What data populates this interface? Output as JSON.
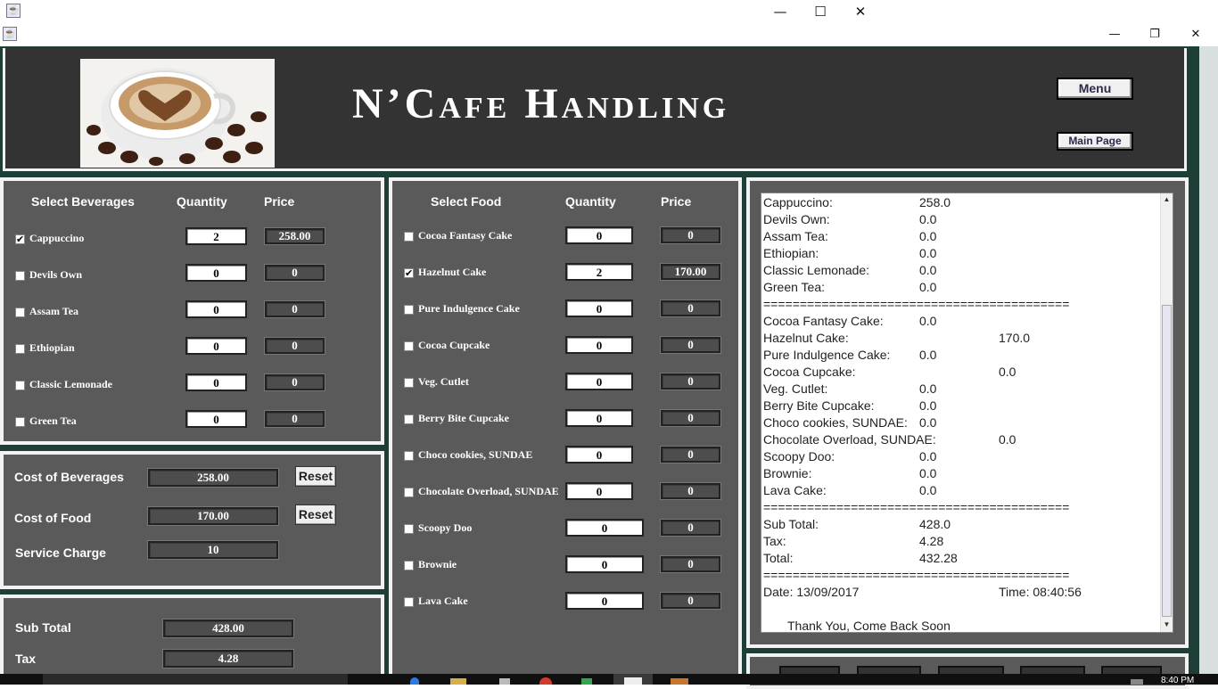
{
  "window": {
    "title_icon": "java-icon",
    "inner_icon": "java-icon",
    "minimize_glyph": "—",
    "maximize_glyph": "☐",
    "close_glyph": "✕",
    "restore_glyph": "❐"
  },
  "header": {
    "title": "N’Cafe Handling",
    "menu_button": "Menu",
    "main_page_button": "Main Page"
  },
  "beverages": {
    "heading_select": "Select Beverages",
    "heading_quantity": "Quantity",
    "heading_price": "Price",
    "items": [
      {
        "label": "Cappuccino",
        "checked": true,
        "quantity": "2",
        "price": "258.00"
      },
      {
        "label": "Devils Own",
        "checked": false,
        "quantity": "0",
        "price": "0"
      },
      {
        "label": "Assam Tea",
        "checked": false,
        "quantity": "0",
        "price": "0"
      },
      {
        "label": "Ethiopian",
        "checked": false,
        "quantity": "0",
        "price": "0"
      },
      {
        "label": "Classic Lemonade",
        "checked": false,
        "quantity": "0",
        "price": "0"
      },
      {
        "label": "Green Tea",
        "checked": false,
        "quantity": "0",
        "price": "0"
      }
    ]
  },
  "food": {
    "heading_select": "Select Food",
    "heading_quantity": "Quantity",
    "heading_price": "Price",
    "items": [
      {
        "label": "Cocoa Fantasy Cake",
        "checked": false,
        "quantity": "0",
        "price": "0"
      },
      {
        "label": "Hazelnut Cake",
        "checked": true,
        "quantity": "2",
        "price": "170.00"
      },
      {
        "label": "Pure Indulgence Cake",
        "checked": false,
        "quantity": "0",
        "price": "0"
      },
      {
        "label": "Cocoa Cupcake",
        "checked": false,
        "quantity": "0",
        "price": "0"
      },
      {
        "label": "Veg. Cutlet",
        "checked": false,
        "quantity": "0",
        "price": "0"
      },
      {
        "label": "Berry Bite Cupcake",
        "checked": false,
        "quantity": "0",
        "price": "0"
      },
      {
        "label": "Choco cookies, SUNDAE",
        "checked": false,
        "quantity": "0",
        "price": "0"
      },
      {
        "label": "Chocolate Overload, SUNDAE",
        "checked": false,
        "quantity": "0",
        "price": "0"
      },
      {
        "label": "Scoopy Doo",
        "checked": false,
        "quantity": "0",
        "price": "0"
      },
      {
        "label": "Brownie",
        "checked": false,
        "quantity": "0",
        "price": "0"
      },
      {
        "label": "Lava Cake",
        "checked": false,
        "quantity": "0",
        "price": "0"
      }
    ]
  },
  "costs": {
    "beverages_label": "Cost of Beverages",
    "beverages_value": "258.00",
    "food_label": "Cost of Food",
    "food_value": "170.00",
    "service_label": "Service Charge",
    "service_value": "10",
    "reset_label": "Reset"
  },
  "totals": {
    "subtotal_label": "Sub Total",
    "subtotal_value": "428.00",
    "tax_label": "Tax",
    "tax_value": "4.28"
  },
  "receipt": {
    "lines": [
      {
        "name": "Cappuccino:",
        "value": "258.0",
        "far": false
      },
      {
        "name": "Devils Own:",
        "value": "0.0",
        "far": false
      },
      {
        "name": "Assam Tea:",
        "value": "0.0",
        "far": false
      },
      {
        "name": "Ethiopian:",
        "value": "0.0",
        "far": false
      },
      {
        "name": "Classic Lemonade:",
        "value": "0.0",
        "far": false
      },
      {
        "name": "Green Tea:",
        "value": "0.0",
        "far": false
      },
      {
        "name": "==========================================",
        "value": "",
        "far": false
      },
      {
        "name": "Cocoa Fantasy Cake:",
        "value": "0.0",
        "far": false
      },
      {
        "name": "Hazelnut Cake:",
        "value": "170.0",
        "far": true
      },
      {
        "name": "Pure Indulgence Cake:",
        "value": "0.0",
        "far": false
      },
      {
        "name": "Cocoa Cupcake:",
        "value": "0.0",
        "far": true
      },
      {
        "name": "Veg. Cutlet:",
        "value": "0.0",
        "far": false
      },
      {
        "name": "Berry Bite Cupcake:",
        "value": "0.0",
        "far": false
      },
      {
        "name": "Choco cookies, SUNDAE:",
        "value": "0.0",
        "far": false
      },
      {
        "name": "Chocolate Overload, SUNDAE:",
        "value": "0.0",
        "far": true
      },
      {
        "name": "Scoopy Doo:",
        "value": "0.0",
        "far": false
      },
      {
        "name": "Brownie:",
        "value": "0.0",
        "far": false
      },
      {
        "name": "Lava Cake:",
        "value": "0.0",
        "far": false
      },
      {
        "name": "==========================================",
        "value": "",
        "far": false
      },
      {
        "name": "Sub Total:",
        "value": "428.0",
        "far": false
      },
      {
        "name": "Tax:",
        "value": "4.28",
        "far": false
      },
      {
        "name": "Total:",
        "value": "432.28",
        "far": false
      },
      {
        "name": "==========================================",
        "value": "",
        "far": false
      },
      {
        "name": "Date: 13/09/2017",
        "value": "Time: 08:40:56",
        "far": true
      },
      {
        "name": "",
        "value": "",
        "far": false
      },
      {
        "name": "       Thank You, Come Back Soon",
        "value": "",
        "far": false
      }
    ]
  },
  "taskbar": {
    "clock": "8:40 PM"
  }
}
